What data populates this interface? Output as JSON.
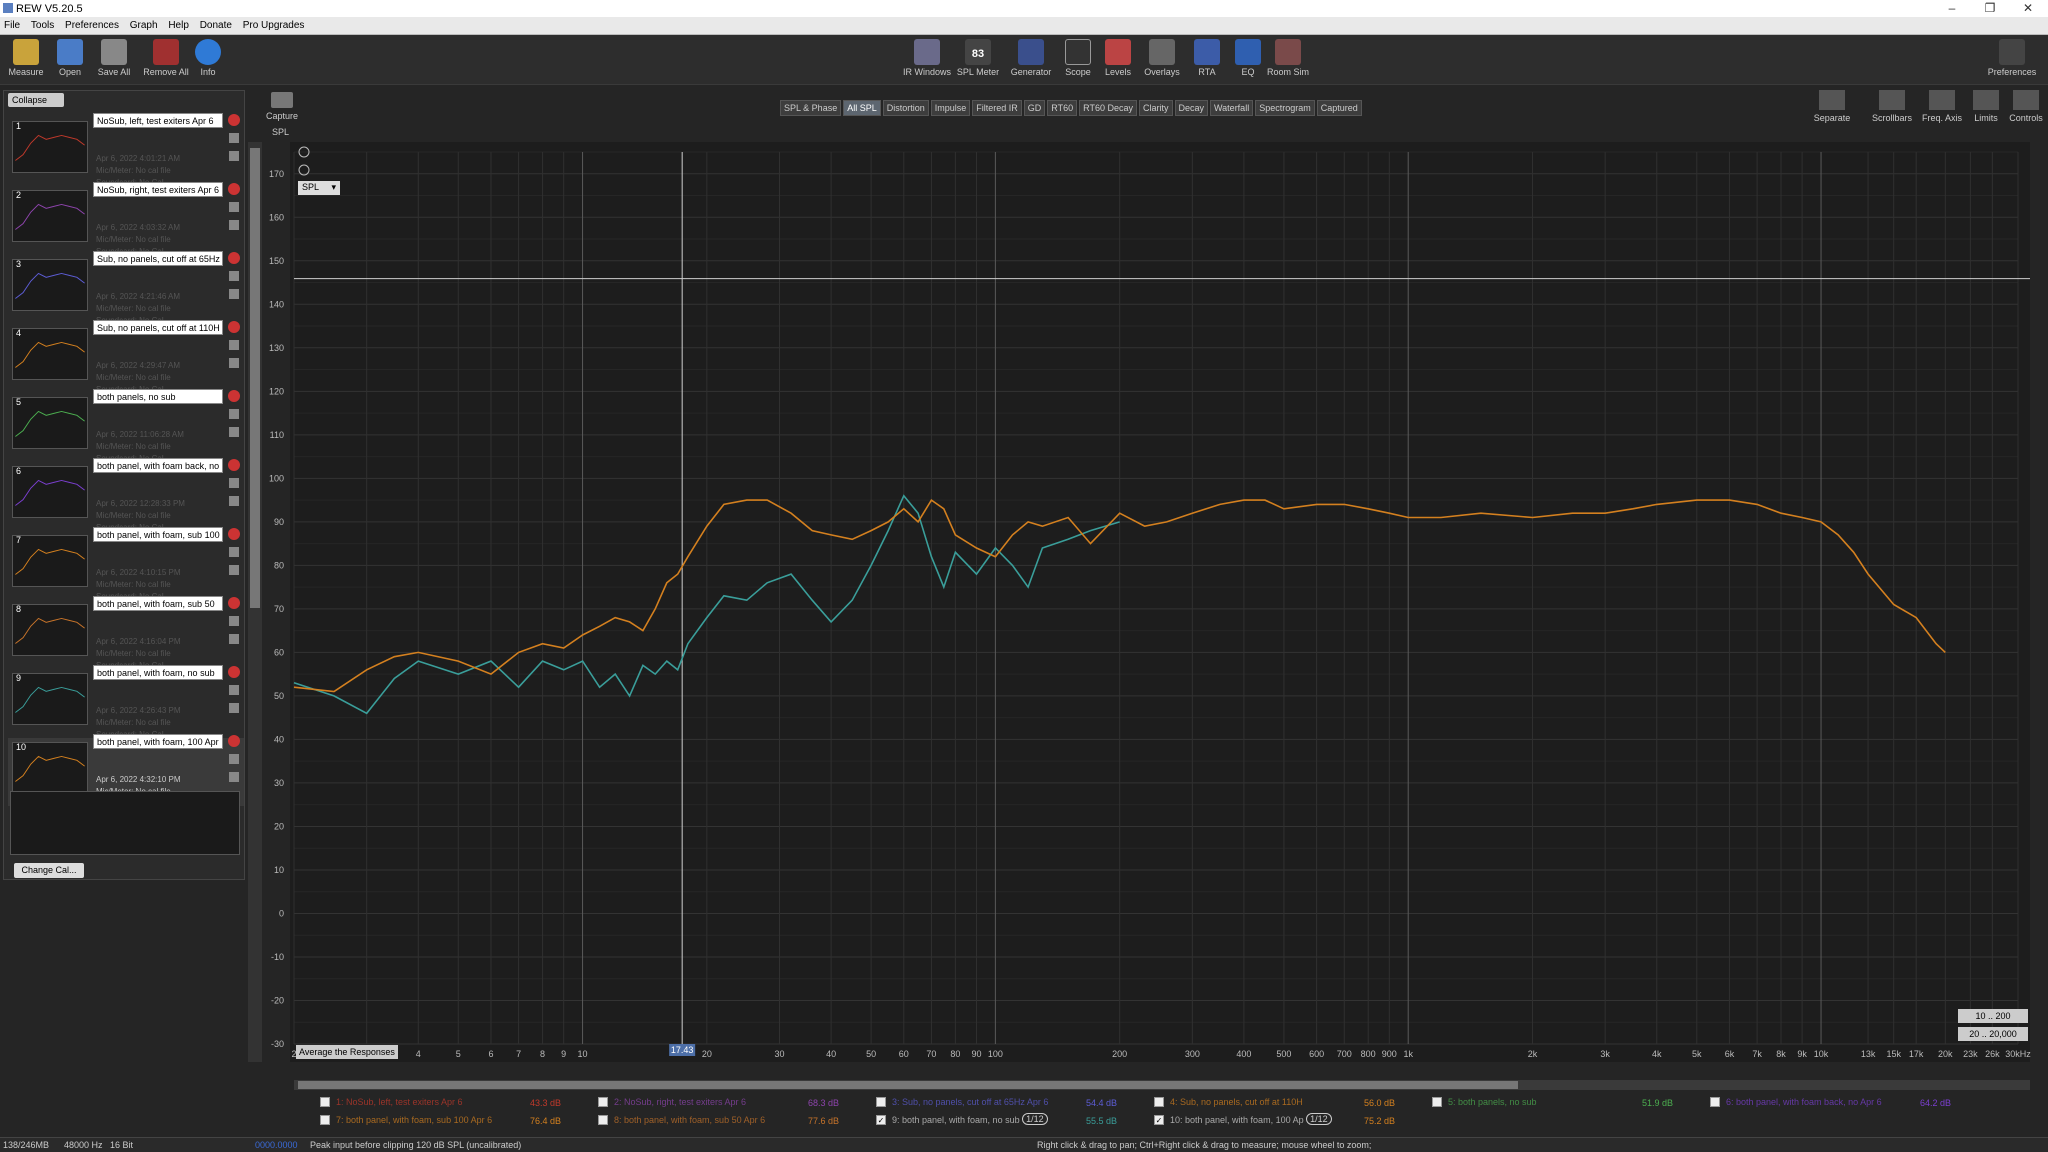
{
  "window": {
    "title": "REW V5.20.5"
  },
  "menu": [
    "File",
    "Tools",
    "Preferences",
    "Graph",
    "Help",
    "Donate",
    "Pro Upgrades"
  ],
  "toolbar": {
    "left": [
      "Measure",
      "Open",
      "Save All",
      "Remove All",
      "Info"
    ],
    "center": [
      "IR Windows",
      "SPL Meter",
      "Generator",
      "Scope",
      "Levels",
      "Overlays",
      "RTA",
      "EQ",
      "Room Sim"
    ],
    "spl_meter_value": "83",
    "spl_meter_unit": "dB SPL",
    "right": "Preferences"
  },
  "sidebar": {
    "collapse": "Collapse",
    "change_cal": "Change Cal...",
    "measurements": [
      {
        "num": "1",
        "name": "NoSub, left, test exiters Apr 6",
        "info": "Apr 6, 2022 4:01:21 AM\nMic/Meter: No cal file\nSoundcard: No Cal",
        "color": "#c0392b"
      },
      {
        "num": "2",
        "name": "NoSub, right, test exiters Apr 6",
        "info": "Apr 6, 2022 4:03:32 AM\nMic/Meter: No cal file\nSoundcard: No Cal",
        "color": "#8e44ad"
      },
      {
        "num": "3",
        "name": "Sub, no panels, cut off at 65Hz",
        "info": "Apr 6, 2022 4:21:46 AM\nMic/Meter: No cal file\nSoundcard: No Cal",
        "color": "#5d5dd6"
      },
      {
        "num": "4",
        "name": "Sub, no panels, cut off at 110H",
        "info": "Apr 6, 2022 4:29:47 AM\nMic/Meter: No cal file\nSoundcard: No Cal",
        "color": "#d4801f"
      },
      {
        "num": "5",
        "name": "both panels, no sub",
        "info": "Apr 6, 2022 11:06:28 AM\nMic/Meter: No cal file\nSoundcard: No Cal",
        "color": "#4caf50"
      },
      {
        "num": "6",
        "name": "both panel, with foam back, no",
        "info": "Apr 6, 2022 12:28:33 PM\nMic/Meter: No cal file\nSoundcard: No Cal",
        "color": "#7b3fd0"
      },
      {
        "num": "7",
        "name": "both panel, with foam, sub 100",
        "info": "Apr 6, 2022 4:10:15 PM\nMic/Meter: No cal file\nSoundcard: No Cal",
        "color": "#d4801f"
      },
      {
        "num": "8",
        "name": "both panel, with foam, sub 50",
        "info": "Apr 6, 2022 4:16:04 PM\nMic/Meter: No cal file\nSoundcard: No Cal",
        "color": "#c8742a"
      },
      {
        "num": "9",
        "name": "both panel, with foam, no sub",
        "info": "Apr 6, 2022 4:26:43 PM\nMic/Meter: No cal file\nSoundcard: No Cal",
        "color": "#3a9e9a"
      },
      {
        "num": "10",
        "name": "both panel, with foam, 100 Apr",
        "info": "Apr 6, 2022 4:32:10 PM\nMic/Meter: No cal file\nSoundcard: No Cal",
        "color": "#d4801f"
      }
    ]
  },
  "capture": "Capture",
  "tabs": [
    "SPL & Phase",
    "All SPL",
    "Distortion",
    "Impulse",
    "Filtered IR",
    "GD",
    "RT60",
    "RT60 Decay",
    "Clarity",
    "Decay",
    "Waterfall",
    "Spectrogram",
    "Captured"
  ],
  "active_tab": "All SPL",
  "right_controls": [
    "Separate",
    "Scrollbars",
    "Freq. Axis",
    "Limits",
    "Controls"
  ],
  "graph": {
    "y_label": "SPL",
    "spl_select": "SPL",
    "cursor_spl": "145.9",
    "cursor_freq": "17.43",
    "avg_button": "Average the Responses",
    "range1": "10 .. 200",
    "range2": "20 .. 20,000"
  },
  "chart_data": {
    "type": "line",
    "xscale": "log",
    "xlim": [
      2,
      30000
    ],
    "ylim": [
      -30,
      175
    ],
    "yticks": [
      "170",
      "160",
      "150",
      "140",
      "130",
      "120",
      "110",
      "100",
      "90",
      "80",
      "70",
      "60",
      "50",
      "40",
      "30",
      "20",
      "10",
      "0",
      "-10",
      "-20",
      "-30"
    ],
    "xticks": [
      "2",
      "3",
      "4",
      "5",
      "6",
      "7",
      "8",
      "9",
      "10",
      "20",
      "30",
      "40",
      "50",
      "60",
      "70",
      "80",
      "90",
      "100",
      "200",
      "300",
      "400",
      "500",
      "600",
      "700",
      "800",
      "900",
      "1k",
      "2k",
      "3k",
      "4k",
      "5k",
      "6k",
      "7k",
      "8k",
      "9k",
      "10k",
      "13k",
      "15k",
      "17k",
      "20k",
      "23k",
      "26k",
      "30kHz"
    ],
    "series": [
      {
        "name": "10: both panel, with foam, 100 Apr",
        "color": "#d4801f",
        "x": [
          2,
          2.5,
          3,
          3.5,
          4,
          5,
          6,
          7,
          8,
          9,
          10,
          11,
          12,
          13,
          14,
          15,
          16,
          17,
          18,
          20,
          22,
          25,
          28,
          32,
          36,
          40,
          45,
          50,
          55,
          60,
          65,
          70,
          75,
          80,
          90,
          100,
          110,
          120,
          130,
          150,
          170,
          200,
          230,
          260,
          300,
          350,
          400,
          450,
          500,
          600,
          700,
          800,
          900,
          1000,
          1200,
          1500,
          2000,
          2500,
          3000,
          3500,
          4000,
          5000,
          6000,
          7000,
          8000,
          9000,
          10000,
          11000,
          12000,
          13000,
          15000,
          17000,
          19000,
          20000
        ],
        "y": [
          52,
          51,
          56,
          59,
          60,
          58,
          55,
          60,
          62,
          61,
          64,
          66,
          68,
          67,
          65,
          70,
          76,
          78,
          82,
          89,
          94,
          95,
          95,
          92,
          88,
          87,
          86,
          88,
          90,
          93,
          90,
          95,
          93,
          87,
          84,
          82,
          87,
          90,
          89,
          91,
          85,
          92,
          89,
          90,
          92,
          94,
          95,
          95,
          93,
          94,
          94,
          93,
          92,
          91,
          91,
          92,
          91,
          92,
          92,
          93,
          94,
          95,
          95,
          94,
          92,
          91,
          90,
          87,
          83,
          78,
          71,
          68,
          62,
          60
        ]
      },
      {
        "name": "9: both panel, with foam, no sub",
        "color": "#3a9e9a",
        "x": [
          2,
          2.5,
          3,
          3.5,
          4,
          5,
          6,
          7,
          8,
          9,
          10,
          11,
          12,
          13,
          14,
          15,
          16,
          17,
          18,
          20,
          22,
          25,
          28,
          32,
          36,
          40,
          45,
          50,
          55,
          60,
          65,
          70,
          75,
          80,
          90,
          100,
          110,
          120,
          130,
          150,
          170,
          200
        ],
        "y": [
          53,
          50,
          46,
          54,
          58,
          55,
          58,
          52,
          58,
          56,
          58,
          52,
          55,
          50,
          57,
          55,
          58,
          56,
          62,
          68,
          73,
          72,
          76,
          78,
          72,
          67,
          72,
          80,
          88,
          96,
          92,
          82,
          75,
          83,
          78,
          84,
          80,
          75,
          84,
          86,
          88,
          90
        ]
      }
    ]
  },
  "legend": [
    {
      "label": "1: NoSub, left, test exiters Apr 6",
      "value": "43.3 dB",
      "color": "#c0392b",
      "checked": false
    },
    {
      "label": "2: NoSub, right, test exiters Apr 6",
      "value": "68.3 dB",
      "color": "#8e44ad",
      "checked": false
    },
    {
      "label": "3: Sub, no panels, cut off at 65Hz Apr 6",
      "value": "54.4 dB",
      "color": "#5d5dd6",
      "checked": false
    },
    {
      "label": "4: Sub, no panels, cut off at 110H",
      "value": "56.0 dB",
      "color": "#d4801f",
      "checked": false
    },
    {
      "label": "5: both panels, no sub",
      "value": "51.9 dB",
      "color": "#4caf50",
      "checked": false
    },
    {
      "label": "6: both panel, with foam back, no Apr 6",
      "value": "64.2 dB",
      "color": "#7b3fd0",
      "checked": false
    },
    {
      "label": "7: both panel, with foam, sub 100 Apr 6",
      "value": "76.4 dB",
      "color": "#d4801f",
      "checked": false
    },
    {
      "label": "8: both panel, with foam, sub 50 Apr 6",
      "value": "77.6 dB",
      "color": "#c8742a",
      "checked": false
    },
    {
      "label": "9: both panel, with foam, no sub",
      "smoothing": "1/12",
      "value": "55.5 dB",
      "color": "#3a9e9a",
      "checked": true
    },
    {
      "label": "10: both panel, with foam, 100 Ap",
      "smoothing": "1/12",
      "value": "75.2 dB",
      "color": "#d4801f",
      "checked": true
    }
  ],
  "status": {
    "memory": "138/246MB",
    "rate": "48000 Hz",
    "bits": "16 Bit",
    "meter": "0000.0000",
    "clip": "Peak input before clipping 120 dB SPL (uncalibrated)",
    "hint": "Right click & drag to pan; Ctrl+Right click & drag to measure; mouse wheel to zoom;"
  }
}
